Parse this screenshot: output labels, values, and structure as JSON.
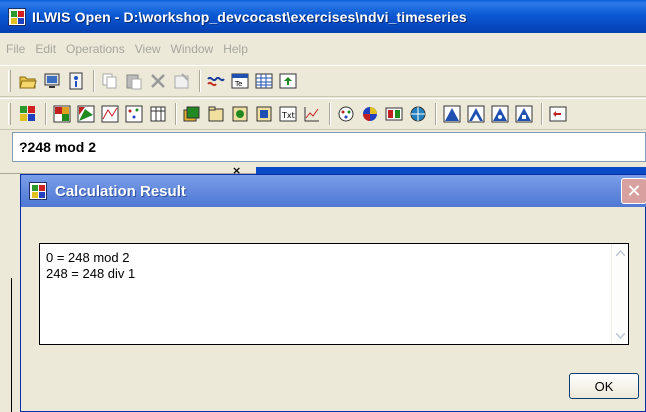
{
  "window": {
    "title": "ILWIS Open - D:\\workshop_devcocast\\exercises\\ndvi_timeseries"
  },
  "menu": [
    "File",
    "Edit",
    "Operations",
    "View",
    "Window",
    "Help"
  ],
  "toolbar1": [
    "open-folder-icon",
    "catalog-icon",
    "properties-icon",
    "copy-icon",
    "paste-icon",
    "delete-icon",
    "edit-properties-icon",
    "map-link-icon",
    "map-view-icon",
    "table-view-icon",
    "up-level-icon"
  ],
  "toolbar2": [
    "ilwis-icon",
    "raster-map-icon",
    "polygon-map-icon",
    "segment-map-icon",
    "point-map-icon",
    "table-icon",
    "map-list-icon",
    "domain-icon",
    "representation-icon",
    "georef-icon",
    "annotation-text-icon",
    "graph-icon",
    "sample-set-icon",
    "color-composite-icon",
    "stereopair-icon",
    "coordsys-icon",
    "filter-a-icon",
    "filter-b-icon",
    "filter-c-icon",
    "filter-d-icon",
    "script-icon"
  ],
  "command_line": {
    "value": "?248 mod 2"
  },
  "dialog": {
    "title": "Calculation Result",
    "lines": [
      "0 = 248 mod 2",
      "248 = 248 div 1"
    ],
    "ok_label": "OK"
  },
  "splitter": {
    "close_label": "×"
  }
}
